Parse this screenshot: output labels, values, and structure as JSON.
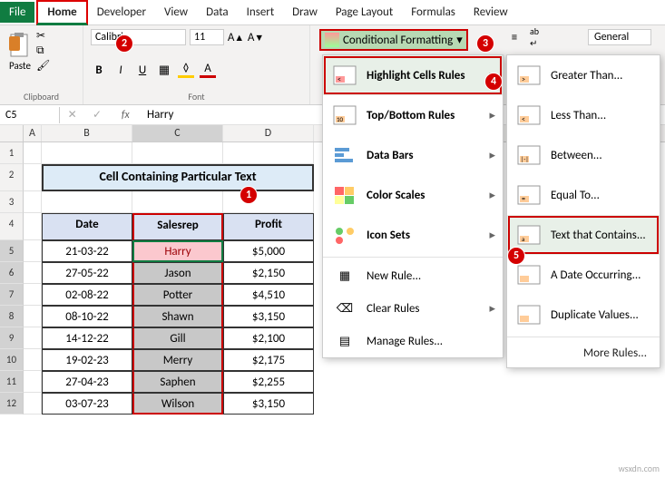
{
  "tabs": {
    "file": "File",
    "home": "Home",
    "developer": "Developer",
    "view": "View",
    "data": "Data",
    "insert": "Insert",
    "draw": "Draw",
    "pagelayout": "Page Layout",
    "formulas": "Formulas",
    "review": "Review"
  },
  "ribbon": {
    "clipboard": {
      "paste": "Paste",
      "label": "Clipboard"
    },
    "font": {
      "name": "Calibri",
      "size": "11",
      "label": "Font"
    },
    "cf": "Conditional Formatting",
    "numfmt": "General"
  },
  "namebox": "C5",
  "formula": "Harry",
  "cols": [
    "A",
    "B",
    "C",
    "D"
  ],
  "title": "Cell Containing Particular Text",
  "headers": {
    "date": "Date",
    "salesrep": "Salesrep",
    "profit": "Profit"
  },
  "rows": [
    {
      "r": 5,
      "date": "21-03-22",
      "rep": "Harry",
      "profit": "$5,000"
    },
    {
      "r": 6,
      "date": "27-05-22",
      "rep": "Jason",
      "profit": "$2,150"
    },
    {
      "r": 7,
      "date": "02-08-22",
      "rep": "Potter",
      "profit": "$4,510"
    },
    {
      "r": 8,
      "date": "08-10-22",
      "rep": "Shawn",
      "profit": "$3,150"
    },
    {
      "r": 9,
      "date": "14-12-22",
      "rep": "Gill",
      "profit": "$2,100"
    },
    {
      "r": 10,
      "date": "19-02-23",
      "rep": "Merry",
      "profit": "$2,175"
    },
    {
      "r": 11,
      "date": "27-04-23",
      "rep": "Saphen",
      "profit": "$2,255"
    },
    {
      "r": 12,
      "date": "03-07-23",
      "rep": "Wilson",
      "profit": "$3,150"
    }
  ],
  "menu1": {
    "hlcells": "Highlight Cells Rules",
    "topbot": "Top/Bottom Rules",
    "databars": "Data Bars",
    "colorscales": "Color Scales",
    "iconsets": "Icon Sets",
    "newrule": "New Rule...",
    "clear": "Clear Rules",
    "manage": "Manage Rules..."
  },
  "menu2": {
    "gt": "Greater Than...",
    "lt": "Less Than...",
    "between": "Between...",
    "eq": "Equal To...",
    "text": "Text that Contains...",
    "date": "A Date Occurring...",
    "dup": "Duplicate Values...",
    "more": "More Rules..."
  },
  "watermark": "wsxdn.com"
}
